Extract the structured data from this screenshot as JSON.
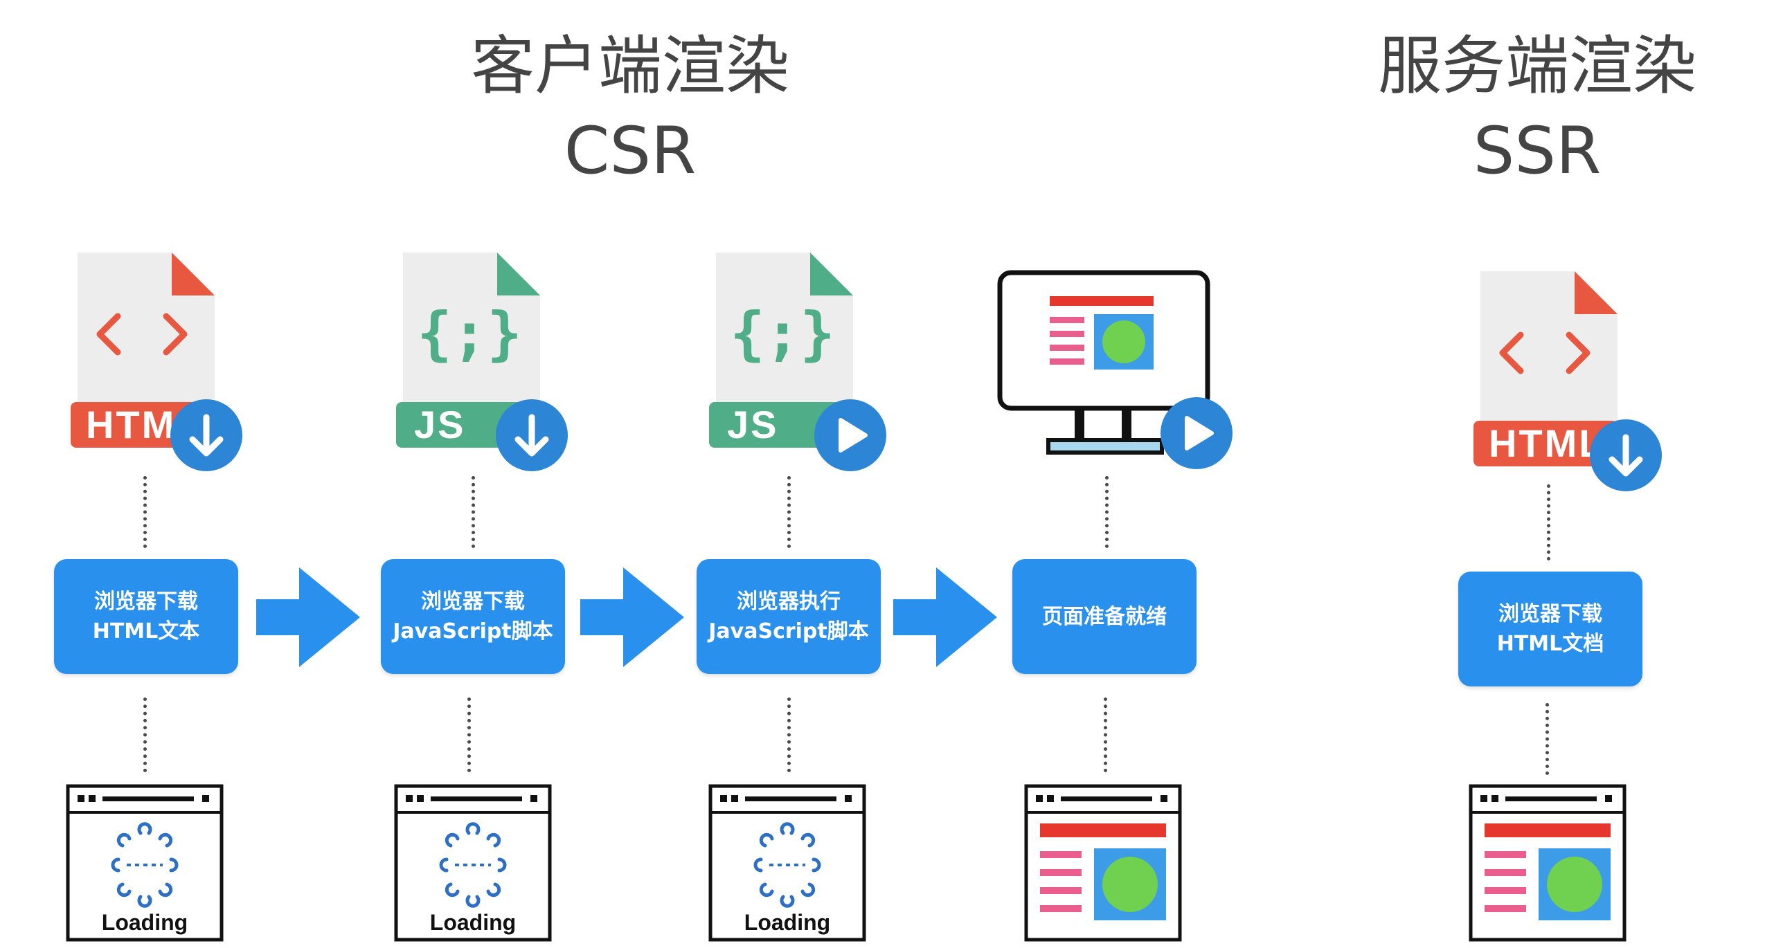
{
  "csr": {
    "title": "客户端渲染",
    "subtitle": "CSR",
    "steps": [
      {
        "label": "浏览器下载\nHTML文本",
        "file_icon": "html-file-download-icon",
        "file_text": "HTM",
        "badge": "download-badge-icon"
      },
      {
        "label": "浏览器下载\nJavaScript脚本",
        "file_icon": "js-file-download-icon",
        "file_text": "JS",
        "badge": "download-badge-icon"
      },
      {
        "label": "浏览器执行\nJavaScript脚本",
        "file_icon": "js-file-execute-icon",
        "file_text": "JS",
        "badge": "play-badge-icon"
      },
      {
        "label": "页面准备就绪",
        "file_icon": "monitor-page-ready-icon",
        "badge": "play-badge-icon"
      }
    ],
    "screens": [
      {
        "state": "loading",
        "label": "Loading"
      },
      {
        "state": "loading",
        "label": "Loading"
      },
      {
        "state": "loading",
        "label": "Loading"
      },
      {
        "state": "ready",
        "label": ""
      }
    ]
  },
  "ssr": {
    "title": "服务端渲染",
    "subtitle": "SSR",
    "step": {
      "label": "浏览器下载\nHTML文档",
      "file_icon": "html-file-download-icon",
      "file_text": "HTML",
      "badge": "download-badge-icon"
    },
    "screen": {
      "state": "ready",
      "label": ""
    }
  },
  "colors": {
    "step_box": "#2a90ee",
    "arrow": "#2a90ee",
    "badge": "#2d85d6",
    "html_red": "#e8573f",
    "js_green": "#4fae87",
    "file_gray": "#ededed",
    "page_red": "#e5372b",
    "page_pink": "#ea5e8d",
    "page_blue": "#3c9ce8",
    "page_green": "#6fd14f"
  }
}
